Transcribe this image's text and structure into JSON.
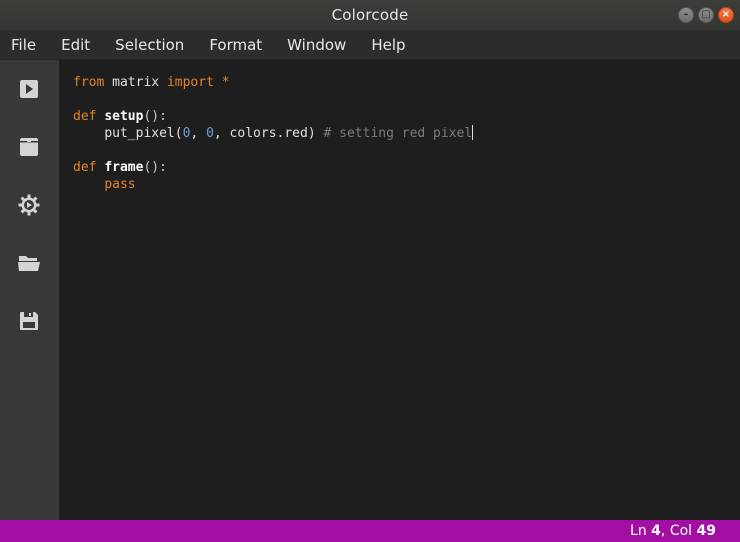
{
  "window": {
    "title": "Colorcode"
  },
  "menu": [
    "File",
    "Edit",
    "Selection",
    "Format",
    "Window",
    "Help"
  ],
  "sidebar": {
    "buttons": [
      {
        "icon": "run-icon"
      },
      {
        "icon": "new-file-icon"
      },
      {
        "icon": "settings-icon"
      },
      {
        "icon": "open-folder-icon"
      },
      {
        "icon": "save-icon"
      }
    ]
  },
  "code": {
    "line1": {
      "kw_from": "from",
      "module": " matrix ",
      "kw_import": "import",
      "star": " *"
    },
    "line3": {
      "kw_def": "def",
      "name": "setup",
      "parens": "():"
    },
    "line4": {
      "indent": "    ",
      "call": "put_pixel(",
      "num1": "0",
      "sep1": ", ",
      "num2": "0",
      "rest": ", colors.red)",
      "comment": " # setting red pixel"
    },
    "line6": {
      "kw_def": "def",
      "name": "frame",
      "parens": "():"
    },
    "line7": {
      "indent": "    ",
      "kw_pass": "pass"
    }
  },
  "status": {
    "ln_label": "Ln ",
    "ln": "4",
    "col_label": ", Col ",
    "col": "49"
  },
  "colors": {
    "status_bar": "#a30fa3",
    "keyword": "#e4832b",
    "number": "#6d9fd8",
    "comment": "#7c7c7c"
  }
}
